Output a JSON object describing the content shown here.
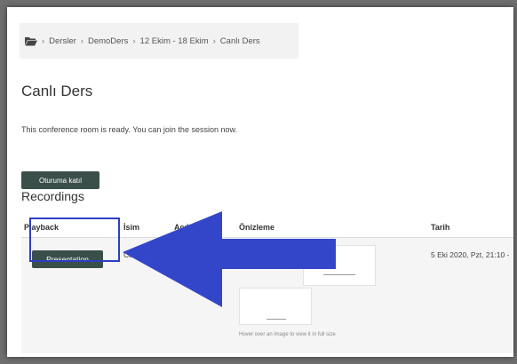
{
  "breadcrumb": {
    "icon": "folder-icon",
    "items": [
      "Dersler",
      "DemoDers",
      "12 Ekim - 18 Ekim",
      "Canlı Ders"
    ],
    "separator": "›"
  },
  "page": {
    "title": "Canlı Ders",
    "status": "This conference room is ready. You can join the session now.",
    "join_button": "Oturuma katıl"
  },
  "recordings": {
    "title": "Recordings",
    "columns": [
      "Playback",
      "İsim",
      "Açıkla",
      "Önizleme",
      "Tarih"
    ],
    "rows": [
      {
        "playback": "Presentation",
        "name": "Canlı D",
        "date": "5 Eki 2020, Pzt, 21:10 -"
      }
    ],
    "hover_hint": "Hover over an image to view it in full size"
  },
  "annotation": {
    "arrow_color": "#3346c9",
    "highlight_color": "#2c3ec4"
  }
}
